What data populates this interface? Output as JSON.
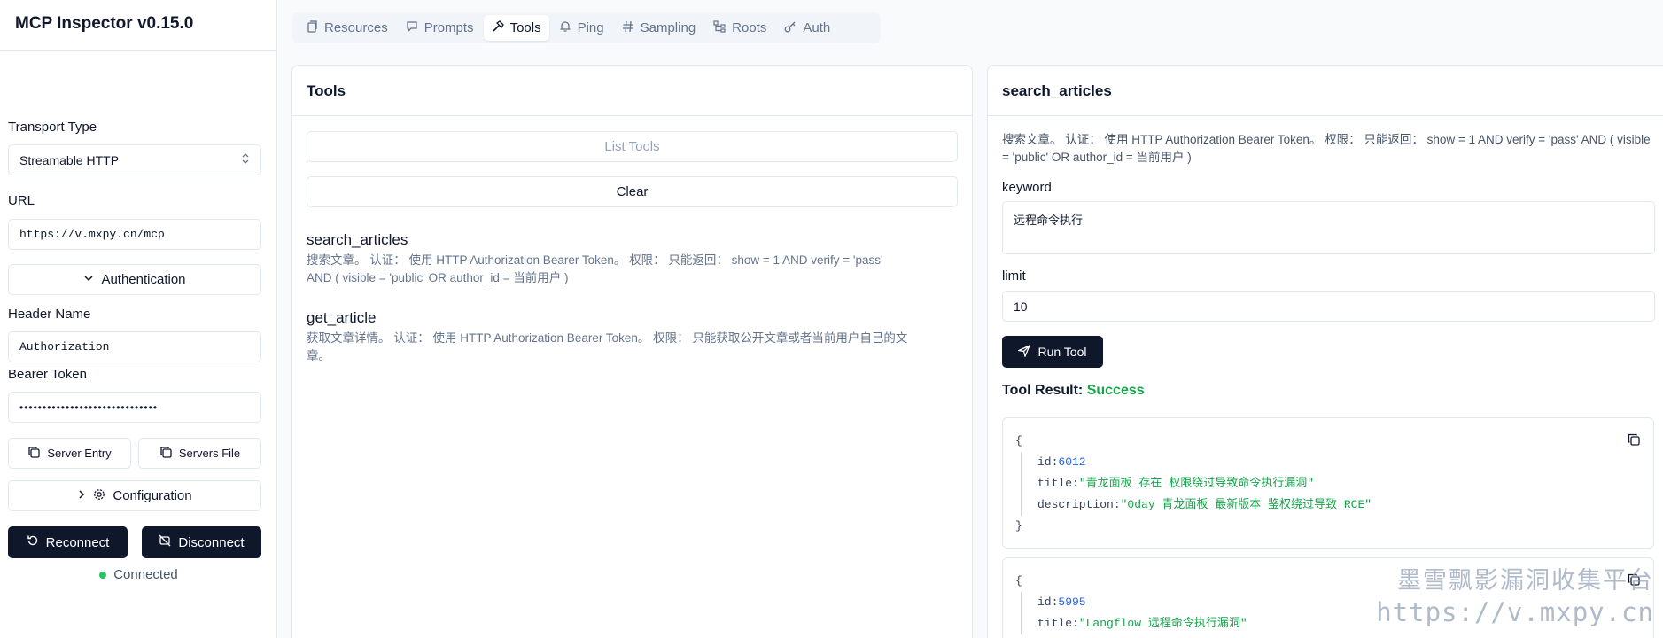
{
  "app": {
    "title": "MCP Inspector v0.15.0"
  },
  "sidebar": {
    "transport_label": "Transport Type",
    "transport_value": "Streamable HTTP",
    "url_label": "URL",
    "url_value": "https://v.mxpy.cn/mcp",
    "auth_toggle": "Authentication",
    "header_name_label": "Header Name",
    "header_name_value": "Authorization",
    "bearer_label": "Bearer Token",
    "bearer_value": "••••••••••••••••••••••••••••••",
    "server_entry": "Server Entry",
    "servers_file": "Servers File",
    "configuration": "Configuration",
    "reconnect": "Reconnect",
    "disconnect": "Disconnect",
    "status": "Connected",
    "status_color": "#22c55e"
  },
  "tabs": [
    {
      "label": "Resources",
      "icon": "file-icon"
    },
    {
      "label": "Prompts",
      "icon": "message-icon"
    },
    {
      "label": "Tools",
      "icon": "hammer-icon",
      "active": true
    },
    {
      "label": "Ping",
      "icon": "bell-icon"
    },
    {
      "label": "Sampling",
      "icon": "hash-icon"
    },
    {
      "label": "Roots",
      "icon": "tree-icon"
    },
    {
      "label": "Auth",
      "icon": "key-icon"
    }
  ],
  "tools_panel": {
    "title": "Tools",
    "list_tools": "List Tools",
    "clear": "Clear",
    "items": [
      {
        "name": "search_articles",
        "desc": "搜索文章。 认证： 使用 HTTP Authorization Bearer Token。 权限： 只能返回： show = 1 AND verify = 'pass' AND ( visible = 'public' OR author_id = 当前用户 )"
      },
      {
        "name": "get_article",
        "desc": "获取文章详情。 认证： 使用 HTTP Authorization Bearer Token。 权限： 只能获取公开文章或者当前用户自己的文章。"
      }
    ]
  },
  "detail_panel": {
    "title": "search_articles",
    "desc": "搜索文章。 认证： 使用 HTTP Authorization Bearer Token。 权限： 只能返回： show = 1 AND verify = 'pass' AND ( visible = 'public' OR author_id = 当前用户 )",
    "keyword_label": "keyword",
    "keyword_value": "远程命令执行",
    "limit_label": "limit",
    "limit_value": "10",
    "run_tool": "Run Tool",
    "result_label": "Tool Result:",
    "result_status": "Success",
    "success_color": "#16a34a",
    "results": [
      {
        "open": "{",
        "close": "}",
        "id_key": "id:",
        "id": "6012",
        "title_key": "title:",
        "title": "\"青龙面板 存在 权限绕过导致命令执行漏洞\"",
        "desc_key": "description:",
        "desc": "\"0day 青龙面板 最新版本 鉴权绕过导致 RCE\""
      },
      {
        "open": "{",
        "id_key": "id:",
        "id": "5995",
        "title_key": "title:",
        "title": "\"Langflow 远程命令执行漏洞\""
      }
    ]
  },
  "watermark": {
    "line1": "墨雪飘影漏洞收集平台",
    "line2": "https://v.mxpy.cn"
  }
}
